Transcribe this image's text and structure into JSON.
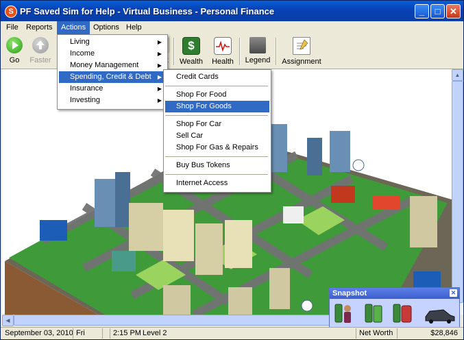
{
  "window": {
    "title": "PF Saved Sim for Help - Virtual Business - Personal Finance",
    "app_icon_letter": "S"
  },
  "title_buttons": {
    "minimize": "_",
    "maximize": "□",
    "close": "✕"
  },
  "menubar": {
    "items": [
      "File",
      "Reports",
      "Actions",
      "Options",
      "Help"
    ],
    "active": "Actions"
  },
  "toolbar": {
    "buttons": [
      {
        "label": "Go",
        "icon": "play-icon",
        "enabled": true
      },
      {
        "label": "Faster",
        "icon": "up-arrow-icon",
        "enabled": false
      },
      {
        "label": "t",
        "icon": "partial-icon",
        "enabled": true
      },
      {
        "label": "Wealth",
        "icon": "dollar-icon",
        "enabled": true
      },
      {
        "label": "Health",
        "icon": "heartbeat-icon",
        "enabled": true
      },
      {
        "label": "Legend",
        "icon": "legend-building-icon",
        "enabled": true
      },
      {
        "label": "Assignment",
        "icon": "assignment-icon",
        "enabled": true
      }
    ]
  },
  "actions_menu": {
    "items": [
      {
        "label": "Living",
        "submenu": true
      },
      {
        "label": "Income",
        "submenu": true
      },
      {
        "label": "Money Management",
        "submenu": true
      },
      {
        "label": "Spending, Credit & Debt",
        "submenu": true,
        "highlighted": true
      },
      {
        "label": "Insurance",
        "submenu": true
      },
      {
        "label": "Investing",
        "submenu": true
      }
    ]
  },
  "spending_submenu": {
    "groups": [
      [
        "Credit Cards"
      ],
      [
        "Shop For Food",
        "Shop For Goods"
      ],
      [
        "Shop For Car",
        "Sell Car",
        "Shop For Gas & Repairs"
      ],
      [
        "Buy Bus Tokens"
      ],
      [
        "Internet Access"
      ]
    ],
    "highlighted": "Shop For Goods"
  },
  "snapshot": {
    "title": "Snapshot",
    "close": "✕",
    "icons": [
      "person-gauge-icon",
      "battery-gauge-icon",
      "gas-gauge-icon",
      "car-icon"
    ]
  },
  "statusbar": {
    "date": "September 03, 2010",
    "day": "Fri",
    "time": "2:15 PM",
    "level": "Level 2",
    "net_worth_label": "Net Worth",
    "net_worth_value": "$28,846"
  },
  "colors": {
    "title_bar": "#0842b8",
    "menu_highlight": "#316ac5",
    "window_face": "#ece9d8"
  }
}
